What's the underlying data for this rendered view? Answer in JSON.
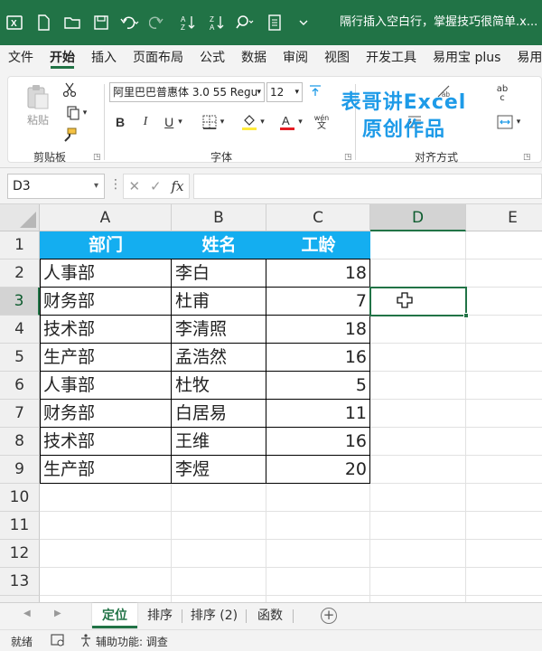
{
  "titlebar": {
    "title": "隔行插入空白行，掌握技巧很简单.x...",
    "icons": [
      "excel-logo-icon",
      "new-file-icon",
      "open-folder-icon",
      "save-icon",
      "undo-icon",
      "redo-icon",
      "sort-ascending-icon",
      "sort-descending-icon",
      "search-icon",
      "form-icon",
      "customize-dropdown-icon"
    ]
  },
  "menu": {
    "tabs": [
      "文件",
      "开始",
      "插入",
      "页面布局",
      "公式",
      "数据",
      "审阅",
      "视图",
      "开发工具",
      "易用宝 plus",
      "易用宝"
    ],
    "active": "开始"
  },
  "ribbon": {
    "clipboard": {
      "label": "剪贴板",
      "paste_label": "粘贴"
    },
    "font": {
      "label": "字体",
      "font_name": "阿里巴巴普惠体 3.0 55 Regu",
      "font_size": "12",
      "bold": "B",
      "italic": "I",
      "underline": "U",
      "font_color": "#e51c23",
      "fill_color": "#ffeb3b",
      "phonetic_top": "wén",
      "phonetic_bottom": "文"
    },
    "alignment": {
      "label": "对齐方式",
      "wrap_top": "ab",
      "wrap_bottom": "c"
    },
    "watermark": {
      "line1": "表哥讲Excel",
      "line2": "原创作品"
    }
  },
  "formula_bar": {
    "name_box": "D3",
    "fx": "fx",
    "content": ""
  },
  "grid": {
    "columns": [
      "A",
      "B",
      "C",
      "D",
      "E"
    ],
    "rows": [
      "1",
      "2",
      "3",
      "4",
      "5",
      "6",
      "7",
      "8",
      "9",
      "10",
      "11",
      "12",
      "13",
      "14"
    ],
    "selected_column": "D",
    "selected_row": "3",
    "active_cell": "D3",
    "header_fill": "#14aef0",
    "table": {
      "headers": [
        "部门",
        "姓名",
        "工龄"
      ],
      "rows": [
        [
          "人事部",
          "李白",
          "18"
        ],
        [
          "财务部",
          "杜甫",
          "7"
        ],
        [
          "技术部",
          "李清照",
          "18"
        ],
        [
          "生产部",
          "孟浩然",
          "16"
        ],
        [
          "人事部",
          "杜牧",
          "5"
        ],
        [
          "财务部",
          "白居易",
          "11"
        ],
        [
          "技术部",
          "王维",
          "16"
        ],
        [
          "生产部",
          "李煜",
          "20"
        ]
      ]
    }
  },
  "sheets": {
    "tabs": [
      "定位",
      "排序",
      "排序 (2)",
      "函数"
    ],
    "active": "定位",
    "add_label": "+"
  },
  "status": {
    "ready": "就绪",
    "accessibility": "辅助功能: 调查"
  }
}
